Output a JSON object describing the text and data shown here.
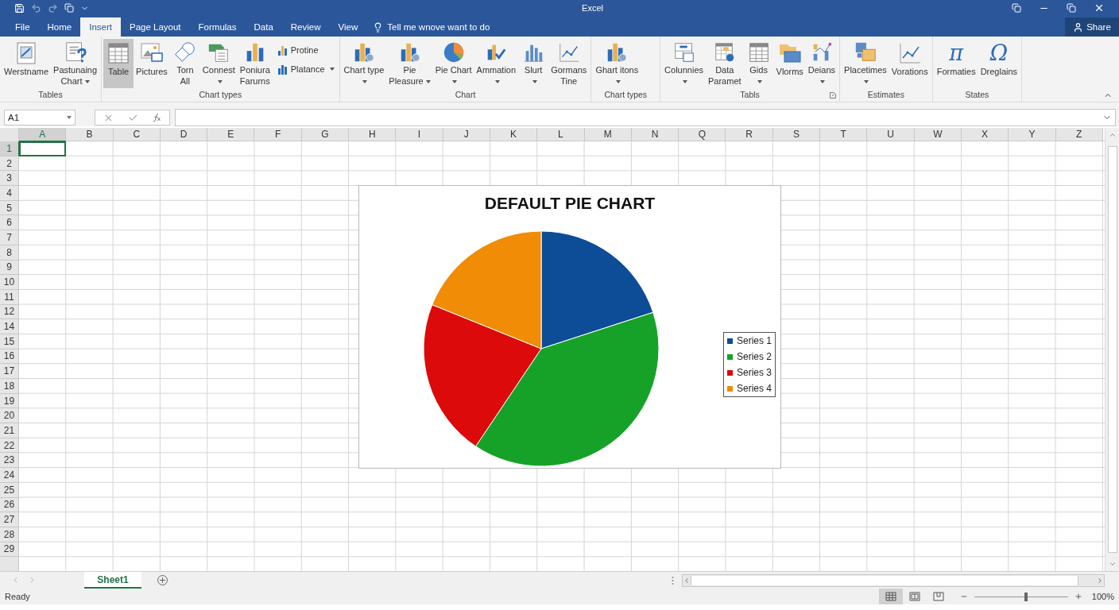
{
  "window": {
    "title": "Excel"
  },
  "ribbon_tabs": [
    {
      "label": "File",
      "selected": false
    },
    {
      "label": "Home",
      "selected": false
    },
    {
      "label": "Insert",
      "selected": true
    },
    {
      "label": "Page Layout",
      "selected": false
    },
    {
      "label": "Formulas",
      "selected": false
    },
    {
      "label": "Data",
      "selected": false
    },
    {
      "label": "Review",
      "selected": false
    },
    {
      "label": "View",
      "selected": false
    }
  ],
  "tell_me": {
    "placeholder": "Tell me wnove want to do"
  },
  "share_button": "Share",
  "ribbon_groups": [
    {
      "label": "Tables",
      "items": [
        {
          "kind": "large",
          "lines": [
            "Werstname"
          ],
          "dropdown": false,
          "selected": false
        },
        {
          "kind": "large",
          "lines": [
            "Pastunaing",
            "Chart"
          ],
          "dropdown": true,
          "selected": false
        }
      ]
    },
    {
      "label": "Chart types",
      "items": [
        {
          "kind": "large",
          "lines": [
            "Table"
          ],
          "dropdown": false,
          "selected": true
        },
        {
          "kind": "large",
          "lines": [
            "Pictures"
          ],
          "dropdown": false,
          "selected": false
        },
        {
          "kind": "large",
          "lines": [
            "Torn",
            "All"
          ],
          "dropdown": false,
          "selected": false
        },
        {
          "kind": "large",
          "lines": [
            "Connest"
          ],
          "dropdown": true,
          "selected": false
        },
        {
          "kind": "large",
          "lines": [
            "Poniura",
            "Farurns"
          ],
          "dropdown": false,
          "selected": false
        },
        {
          "kind": "stack",
          "items": [
            {
              "lines": [
                "Protine"
              ],
              "dropdown": false
            },
            {
              "lines": [
                "Platance"
              ],
              "dropdown": true
            }
          ]
        }
      ]
    },
    {
      "label": "Chart",
      "items": [
        {
          "kind": "large",
          "lines": [
            "Chart type"
          ],
          "dropdown": true,
          "selected": false
        },
        {
          "kind": "large",
          "lines": [
            "Pie",
            "Pleasure"
          ],
          "dropdown": true,
          "selected": false
        },
        {
          "kind": "large",
          "lines": [
            "Pie Chart"
          ],
          "dropdown": true,
          "selected": false
        },
        {
          "kind": "large",
          "lines": [
            "Ammation"
          ],
          "dropdown": true,
          "selected": false
        },
        {
          "kind": "large",
          "lines": [
            "Slurt"
          ],
          "dropdown": true,
          "selected": false
        },
        {
          "kind": "large",
          "lines": [
            "Gormans",
            "Tine"
          ],
          "dropdown": false,
          "selected": false
        }
      ]
    },
    {
      "label": "Chart types",
      "items": [
        {
          "kind": "large",
          "lines": [
            "Ghart itons"
          ],
          "dropdown": true,
          "selected": false
        }
      ]
    },
    {
      "label": "Tabls",
      "launcher": true,
      "items": [
        {
          "kind": "large",
          "lines": [
            "Colunnies"
          ],
          "dropdown": true,
          "selected": false
        },
        {
          "kind": "large",
          "lines": [
            "Data",
            "Paramet"
          ],
          "dropdown": false,
          "selected": false
        },
        {
          "kind": "large",
          "lines": [
            "Gids"
          ],
          "dropdown": true,
          "selected": false
        },
        {
          "kind": "large",
          "lines": [
            "Vlorms"
          ],
          "dropdown": false,
          "selected": false
        },
        {
          "kind": "large",
          "lines": [
            "Deians"
          ],
          "dropdown": true,
          "selected": false
        }
      ]
    },
    {
      "label": "Estimates",
      "items": [
        {
          "kind": "large",
          "lines": [
            "Placetimes"
          ],
          "dropdown": true,
          "selected": false
        },
        {
          "kind": "large",
          "lines": [
            "Vorations"
          ],
          "dropdown": false,
          "selected": false
        }
      ]
    },
    {
      "label": "States",
      "items": [
        {
          "kind": "large",
          "lines": [
            "Formaties"
          ],
          "glyph": "π",
          "dropdown": false,
          "selected": false
        },
        {
          "kind": "large",
          "lines": [
            "Dreglains"
          ],
          "glyph": "Ω",
          "dropdown": false,
          "selected": false
        }
      ]
    }
  ],
  "name_box": "A1",
  "columns": [
    {
      "label": "A",
      "selected": true
    },
    {
      "label": "B",
      "selected": false
    },
    {
      "label": "C",
      "selected": false
    },
    {
      "label": "D",
      "selected": false
    },
    {
      "label": "E",
      "selected": false
    },
    {
      "label": "F",
      "selected": false
    },
    {
      "label": "G",
      "selected": false
    },
    {
      "label": "H",
      "selected": false
    },
    {
      "label": "I",
      "selected": false
    },
    {
      "label": "J",
      "selected": false
    },
    {
      "label": "K",
      "selected": false
    },
    {
      "label": "L",
      "selected": false
    },
    {
      "label": "M",
      "selected": false
    },
    {
      "label": "N",
      "selected": false
    },
    {
      "label": "Q",
      "selected": false
    },
    {
      "label": "R",
      "selected": false
    },
    {
      "label": "S",
      "selected": false
    },
    {
      "label": "T",
      "selected": false
    },
    {
      "label": "U",
      "selected": false
    },
    {
      "label": "W",
      "selected": false
    },
    {
      "label": "X",
      "selected": false
    },
    {
      "label": "Y",
      "selected": false
    },
    {
      "label": "Z",
      "selected": false
    }
  ],
  "rows": [
    {
      "label": "1",
      "selected": true
    },
    {
      "label": "2",
      "selected": false
    },
    {
      "label": "3",
      "selected": false
    },
    {
      "label": "4",
      "selected": false
    },
    {
      "label": "5",
      "selected": false
    },
    {
      "label": "6",
      "selected": false
    },
    {
      "label": "7",
      "selected": false
    },
    {
      "label": "8",
      "selected": false
    },
    {
      "label": "9",
      "selected": false
    },
    {
      "label": "10",
      "selected": false
    },
    {
      "label": "11",
      "selected": false
    },
    {
      "label": "12",
      "selected": false
    },
    {
      "label": "14",
      "selected": false
    },
    {
      "label": "15",
      "selected": false
    },
    {
      "label": "16",
      "selected": false
    },
    {
      "label": "17",
      "selected": false
    },
    {
      "label": "18",
      "selected": false
    },
    {
      "label": "19",
      "selected": false
    },
    {
      "label": "20",
      "selected": false
    },
    {
      "label": "21",
      "selected": false
    },
    {
      "label": "22",
      "selected": false
    },
    {
      "label": "23",
      "selected": false
    },
    {
      "label": "24",
      "selected": false
    },
    {
      "label": "25",
      "selected": false
    },
    {
      "label": "26",
      "selected": false
    },
    {
      "label": "27",
      "selected": false
    },
    {
      "label": "28",
      "selected": false
    },
    {
      "label": "29",
      "selected": false
    }
  ],
  "chart": {
    "title": "DEFAULT PIE CHART",
    "legend": [
      {
        "name": "Series 1",
        "color": "#0d4c96"
      },
      {
        "name": "Series 2",
        "color": "#16a228"
      },
      {
        "name": "Series 3",
        "color": "#dc0a0a"
      },
      {
        "name": "Series 4",
        "color": "#f08c06"
      }
    ]
  },
  "sheet_tabs": [
    {
      "label": "Sheet1",
      "selected": true
    }
  ],
  "status_bar": {
    "text": "Ready",
    "view_buttons": [
      {
        "kind": "normal",
        "selected": true
      },
      {
        "kind": "page-layout",
        "selected": false
      },
      {
        "kind": "page-break",
        "selected": false
      }
    ],
    "zoom": {
      "level": 0.55,
      "reading": "100%"
    }
  }
}
